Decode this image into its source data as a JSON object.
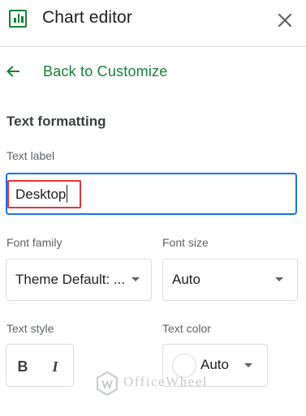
{
  "header": {
    "title": "Chart editor",
    "chart_icon": "bar-chart-icon",
    "close_icon": "close-icon"
  },
  "nav": {
    "back_label": "Back to Customize",
    "back_icon": "arrow-left-icon"
  },
  "section": {
    "title": "Text formatting"
  },
  "text_label": {
    "label": "Text label",
    "value": "Desktop"
  },
  "font_family": {
    "label": "Font family",
    "value": "Theme Default: ..."
  },
  "font_size": {
    "label": "Font size",
    "value": "Auto"
  },
  "text_style": {
    "label": "Text style",
    "bold": "B",
    "italic": "I"
  },
  "text_color": {
    "label": "Text color",
    "value": "Auto",
    "swatch_color": "#ffffff"
  },
  "watermark": {
    "text": "OfficeWheel"
  },
  "colors": {
    "accent_green": "#188038",
    "focus_blue": "#1a73e8",
    "highlight_red": "#e8323a"
  }
}
